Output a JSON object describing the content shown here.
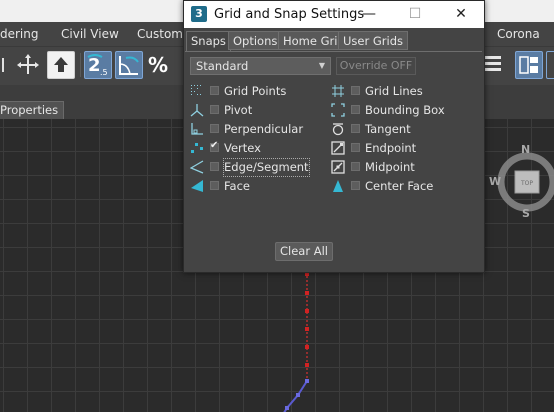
{
  "background_ui": {
    "menu_items": [
      "dering",
      "Civil View",
      "Customiz",
      "Corona"
    ],
    "properties_tab": "Properties",
    "viewcube": {
      "north": "N",
      "west": "W",
      "south": "S",
      "top_face": "TOP"
    }
  },
  "dialog": {
    "title": "Grid and Snap Settings",
    "icon_glyph": "3",
    "window_buttons": {
      "minimize": "—",
      "maximize": "☐",
      "close": "✕"
    },
    "tabs": [
      {
        "label": "Snaps",
        "active": true
      },
      {
        "label": "Options",
        "active": false
      },
      {
        "label": "Home Grid",
        "active": false
      },
      {
        "label": "User Grids",
        "active": false
      }
    ],
    "preset": {
      "value": "Standard",
      "arrow": "▼"
    },
    "override_button": "Override OFF",
    "snaps_left": [
      {
        "label": "Grid Points",
        "checked": false,
        "icon": "grid-points-icon"
      },
      {
        "label": "Pivot",
        "checked": false,
        "icon": "pivot-icon"
      },
      {
        "label": "Perpendicular",
        "checked": false,
        "icon": "perpendicular-icon"
      },
      {
        "label": "Vertex",
        "checked": true,
        "icon": "vertex-icon"
      },
      {
        "label": "Edge/Segment",
        "checked": false,
        "icon": "edge-segment-icon"
      },
      {
        "label": "Face",
        "checked": false,
        "icon": "face-icon"
      }
    ],
    "snaps_right": [
      {
        "label": "Grid Lines",
        "checked": false,
        "icon": "grid-lines-icon"
      },
      {
        "label": "Bounding Box",
        "checked": false,
        "icon": "bounding-box-icon"
      },
      {
        "label": "Tangent",
        "checked": false,
        "icon": "tangent-icon"
      },
      {
        "label": "Endpoint",
        "checked": false,
        "icon": "endpoint-icon"
      },
      {
        "label": "Midpoint",
        "checked": false,
        "icon": "midpoint-icon"
      },
      {
        "label": "Center Face",
        "checked": false,
        "icon": "center-face-icon"
      }
    ],
    "clear_all_button": "Clear All"
  },
  "colors": {
    "ui_panel": "#444444",
    "viewport_bg": "#2b2b2b",
    "active_tool": "#5a7ca3",
    "accent_cyan": "#35b8d3",
    "vertex_red": "#d22222",
    "line_blue": "#5a5ad0"
  }
}
